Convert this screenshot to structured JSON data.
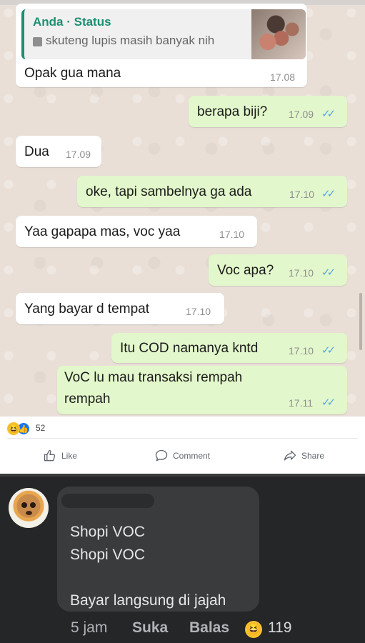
{
  "chat": {
    "quote": {
      "name": "Anda · Status",
      "text": "skuteng lupis masih banyak nih"
    },
    "messages": [
      {
        "dir": "in",
        "text": "Opak gua mana",
        "time": "17.08"
      },
      {
        "dir": "out",
        "text": "berapa biji?",
        "time": "17.09",
        "ticks": "✓✓"
      },
      {
        "dir": "in",
        "text": "Dua",
        "time": "17.09"
      },
      {
        "dir": "out",
        "text": "oke, tapi sambelnya ga ada",
        "time": "17.10",
        "ticks": "✓✓"
      },
      {
        "dir": "in",
        "text": "Yaa gapapa mas, voc yaa",
        "time": "17.10"
      },
      {
        "dir": "out",
        "text": "Voc apa?",
        "time": "17.10",
        "ticks": "✓✓"
      },
      {
        "dir": "in",
        "text": "Yang bayar d tempat",
        "time": "17.10"
      },
      {
        "dir": "out",
        "text": "Itu COD namanya kntd",
        "time": "17.10",
        "ticks": "✓✓"
      },
      {
        "dir": "out",
        "line1": "VoC lu mau transaksi rempah",
        "line2": "rempah",
        "time": "17.11",
        "ticks": "✓✓"
      }
    ]
  },
  "post": {
    "reaction_count": "52",
    "actions": {
      "like": "Like",
      "comment": "Comment",
      "share": "Share"
    }
  },
  "comment": {
    "lines": [
      "Shopi VOC",
      "Shopi VOC",
      "Bayar langsung di jajah"
    ],
    "time": "5 jam",
    "like_label": "Suka",
    "reply_label": "Balas",
    "reaction_count": "119"
  },
  "colors": {
    "chat_bg": "#e9dfd7",
    "incoming": "#ffffff",
    "outgoing": "#e2f7cb",
    "ticks": "#5aa5e8",
    "quote_accent": "#1d8f72",
    "dark_bg": "#252627",
    "comment_bubble": "#3a3b3c"
  },
  "icons": [
    "image-icon",
    "double-tick-icon",
    "haha-reaction-icon",
    "like-reaction-icon",
    "like-icon",
    "comment-icon",
    "share-icon",
    "avatar",
    "haha-emoji-icon"
  ]
}
